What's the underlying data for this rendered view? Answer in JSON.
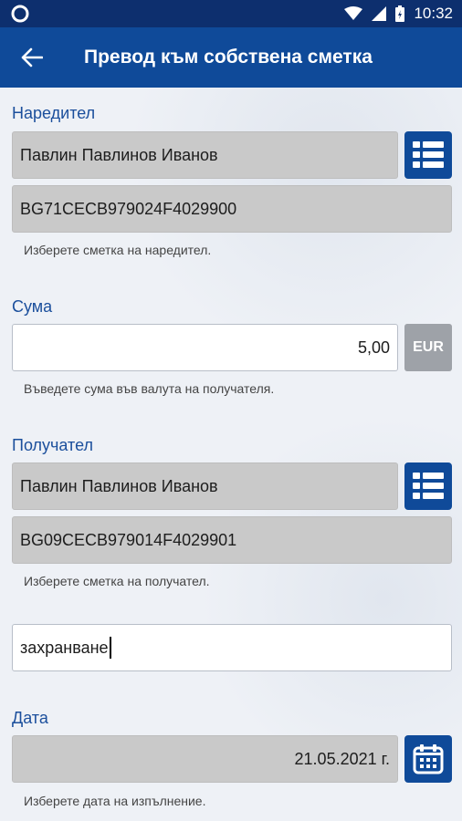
{
  "status_bar": {
    "time": "10:32"
  },
  "app_bar": {
    "title": "Превод към собствена сметка"
  },
  "payer": {
    "label": "Наредител",
    "name": "Павлин Павлинов Иванов",
    "iban": "BG71CECB979024F4029900",
    "hint": "Изберете сметка на наредител."
  },
  "amount": {
    "label": "Сума",
    "value": "5,00",
    "currency": "EUR",
    "hint": "Въведете сума във валута на получателя."
  },
  "recipient": {
    "label": "Получател",
    "name": "Павлин Павлинов Иванов",
    "iban": "BG09CECB979014F4029901",
    "hint": "Изберете сметка на получател."
  },
  "description": {
    "value": "захранване"
  },
  "date": {
    "label": "Дата",
    "value": "21.05.2021 г.",
    "hint": "Изберете дата на изпълнение."
  },
  "colors": {
    "primary": "#0f4a99",
    "statusbar": "#0d2f6e",
    "label": "#1b4f9c",
    "field_gray": "#c9c9c9"
  }
}
